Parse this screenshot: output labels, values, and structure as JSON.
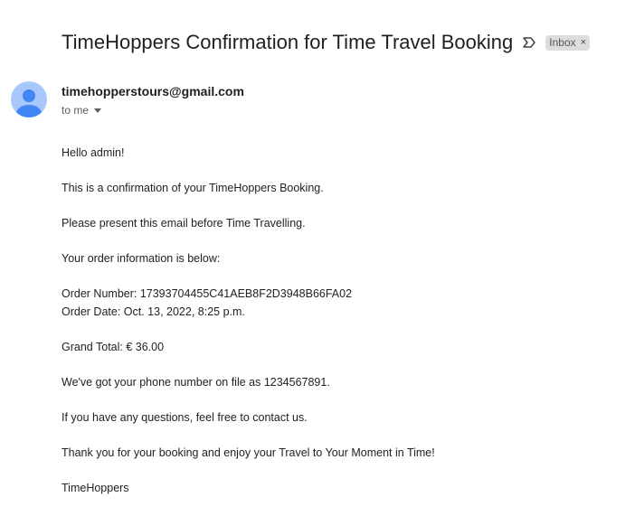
{
  "email": {
    "subject": "TimeHoppers Confirmation for Time Travel Booking",
    "label": "Inbox",
    "label_close": "×",
    "sender": "timehopperstours@gmail.com",
    "recipient": "to me",
    "body": {
      "greeting": "Hello admin!",
      "line_confirmation": "This is a confirmation of your TimeHoppers Booking.",
      "line_present": "Please present this email before Time Travelling.",
      "line_order_intro": "Your order information is below:",
      "order_number": "Order Number: 17393704455C41AEB8F2D3948B66FA02",
      "order_date": "Order Date: Oct. 13, 2022, 8:25 p.m.",
      "grand_total": "Grand Total: € 36.00",
      "phone_line": "We've got your phone number on file as 1234567891.",
      "questions_line": "If you have any questions, feel free to contact us.",
      "thanks_line": "Thank you for your booking and enjoy your Travel to Your Moment in Time!",
      "signature": "TimeHoppers"
    }
  },
  "colors": {
    "avatar_bg": "#a8c7fa",
    "avatar_fg": "#4285f4",
    "chip_bg": "#dddddd"
  },
  "icons": {
    "important": "label-important-icon",
    "avatar": "person-avatar-icon",
    "dropdown": "caret-down-icon",
    "close": "close-icon"
  }
}
